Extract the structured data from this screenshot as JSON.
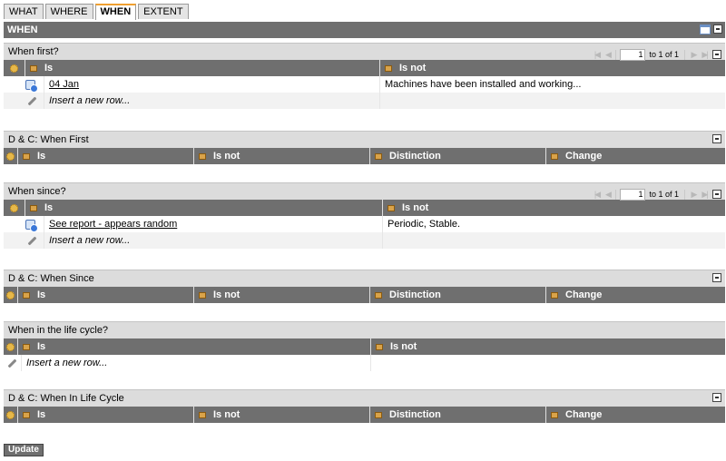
{
  "tabs": [
    "WHAT",
    "WHERE",
    "WHEN",
    "EXTENT"
  ],
  "active_tab": "WHEN",
  "mainbar": {
    "title": "WHEN"
  },
  "when_first": {
    "title": "When first?",
    "pager": {
      "page": "1",
      "label": "to 1 of 1"
    },
    "columns": [
      "Is",
      "Is not"
    ],
    "rows": [
      {
        "is": "04 Jan",
        "is_not": "Machines have been installed and working..."
      }
    ],
    "insert_label": "Insert a new row..."
  },
  "dc_when_first": {
    "title": "D & C: When First",
    "columns": [
      "Is",
      "Is not",
      "Distinction",
      "Change"
    ]
  },
  "when_since": {
    "title": "When since?",
    "pager": {
      "page": "1",
      "label": "to 1 of 1"
    },
    "columns": [
      "Is",
      "Is not"
    ],
    "rows": [
      {
        "is": "See report - appears random",
        "is_not": "Periodic, Stable."
      }
    ],
    "insert_label": "Insert a new row..."
  },
  "dc_when_since": {
    "title": "D & C: When Since",
    "columns": [
      "Is",
      "Is not",
      "Distinction",
      "Change"
    ]
  },
  "when_lifecycle": {
    "title": "When in the life cycle?",
    "columns": [
      "Is",
      "Is not"
    ],
    "insert_label": "Insert a new row..."
  },
  "dc_when_lifecycle": {
    "title": "D & C: When In Life Cycle",
    "columns": [
      "Is",
      "Is not",
      "Distinction",
      "Change"
    ]
  },
  "update_label": "Update"
}
